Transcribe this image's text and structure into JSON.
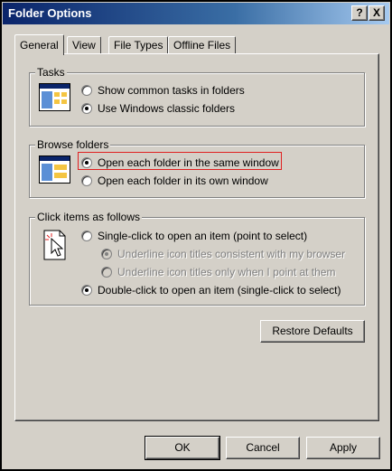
{
  "window": {
    "title": "Folder Options",
    "help_glyph": "?",
    "close_glyph": "X"
  },
  "tabs": [
    {
      "label": "General",
      "active": true
    },
    {
      "label": "View",
      "active": false
    },
    {
      "label": "File Types",
      "active": false
    },
    {
      "label": "Offline Files",
      "active": false
    }
  ],
  "tasks": {
    "label": "Tasks",
    "options": [
      {
        "label": "Show common tasks in folders",
        "checked": false
      },
      {
        "label": "Use Windows classic folders",
        "checked": true
      }
    ]
  },
  "browse": {
    "label": "Browse folders",
    "options": [
      {
        "label": "Open each folder in the same window",
        "checked": true,
        "highlighted": true
      },
      {
        "label": "Open each folder in its own window",
        "checked": false
      }
    ]
  },
  "click_items": {
    "label": "Click items as follows",
    "single_click": {
      "label": "Single-click to open an item (point to select)",
      "checked": false
    },
    "sub_options": [
      {
        "label": "Underline icon titles consistent with my browser",
        "checked": true,
        "disabled": true
      },
      {
        "label": "Underline icon titles only when I point at them",
        "checked": false,
        "disabled": true
      }
    ],
    "double_click": {
      "label": "Double-click to open an item (single-click to select)",
      "checked": true
    }
  },
  "buttons": {
    "restore_defaults": "Restore Defaults",
    "ok": "OK",
    "cancel": "Cancel",
    "apply": "Apply"
  },
  "colors": {
    "title_gradient_start": "#0a246a",
    "title_gradient_end": "#a6caf0",
    "face": "#d4d0c8",
    "highlight_box": "#e02020"
  },
  "icons": {
    "tasks": "classic-folder-window-icon",
    "browse": "folder-window-icon",
    "click": "pointer-cursor-icon"
  }
}
